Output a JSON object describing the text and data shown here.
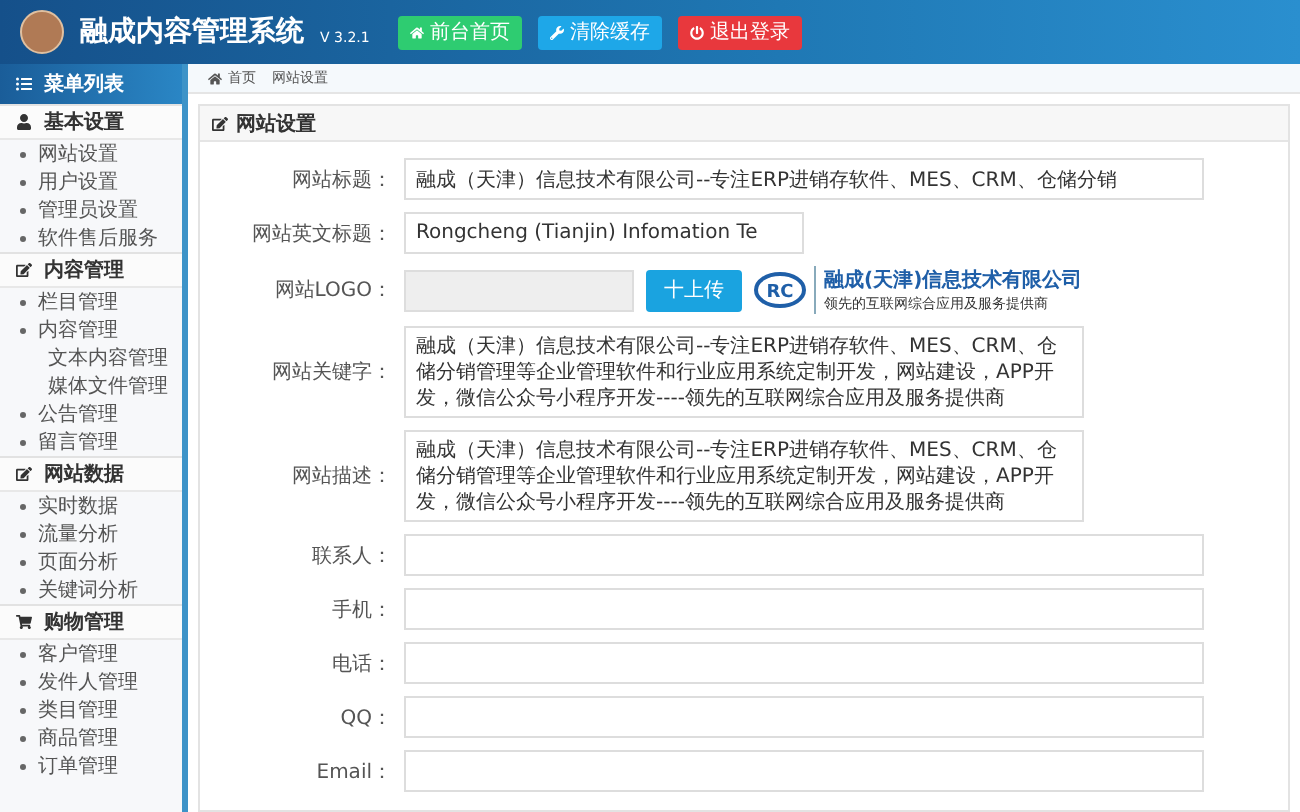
{
  "header": {
    "title": "融成内容管理系统",
    "version": "V 3.2.1",
    "buttons": [
      {
        "kind": "home",
        "label": "前台首页",
        "color": "#2ecc71"
      },
      {
        "kind": "clear",
        "label": "清除缓存",
        "color": "#1ea7e8"
      },
      {
        "kind": "logout",
        "label": "退出登录",
        "color": "#e8383d"
      }
    ]
  },
  "sidebar": {
    "title": "菜单列表",
    "groups": [
      {
        "kind": "user",
        "label": "基本设置",
        "items": [
          {
            "label": "网站设置"
          },
          {
            "label": "用户设置"
          },
          {
            "label": "管理员设置"
          },
          {
            "label": "软件售后服务"
          }
        ]
      },
      {
        "kind": "edit",
        "label": "内容管理",
        "items": [
          {
            "label": "栏目管理"
          },
          {
            "label": "内容管理",
            "children": [
              {
                "label": "文本内容管理"
              },
              {
                "label": "媒体文件管理"
              }
            ]
          },
          {
            "label": "公告管理"
          },
          {
            "label": "留言管理"
          }
        ]
      },
      {
        "kind": "edit",
        "label": "网站数据",
        "items": [
          {
            "label": "实时数据"
          },
          {
            "label": "流量分析"
          },
          {
            "label": "页面分析"
          },
          {
            "label": "关键词分析"
          }
        ]
      },
      {
        "kind": "cart",
        "label": "购物管理",
        "items": [
          {
            "label": "客户管理"
          },
          {
            "label": "发件人管理"
          },
          {
            "label": "类目管理"
          },
          {
            "label": "商品管理"
          },
          {
            "label": "订单管理"
          }
        ]
      }
    ]
  },
  "breadcrumb": [
    "首页",
    "网站设置"
  ],
  "panel": {
    "title": "网站设置",
    "fields": [
      {
        "kind": "input",
        "label": "网站标题：",
        "value": "融成（天津）信息技术有限公司--专注ERP进销存软件、MES、CRM、仓储分销",
        "wide": true
      },
      {
        "kind": "input",
        "label": "网站英文标题：",
        "value": "Rongcheng (Tianjin) Infomation Te",
        "wide": false
      },
      {
        "kind": "logo",
        "label": "网站LOGO：",
        "button": "十上传",
        "logo_text": "融成(天津)信息技术有限公司",
        "logo_sub": "领先的互联网综合应用及服务提供商",
        "logo_mark": "RC"
      },
      {
        "kind": "textarea",
        "label": "网站关键字：",
        "value": "融成（天津）信息技术有限公司--专注ERP进销存软件、MES、CRM、仓储分销管理等企业管理软件和行业应用系统定制开发，网站建设，APP开发，微信公众号小程序开发----领先的互联网综合应用及服务提供商"
      },
      {
        "kind": "textarea",
        "label": "网站描述：",
        "value": "融成（天津）信息技术有限公司--专注ERP进销存软件、MES、CRM、仓储分销管理等企业管理软件和行业应用系统定制开发，网站建设，APP开发，微信公众号小程序开发----领先的互联网综合应用及服务提供商"
      },
      {
        "kind": "input",
        "label": "联系人：",
        "wide": true
      },
      {
        "kind": "input",
        "label": "手机：",
        "wide": true
      },
      {
        "kind": "input",
        "label": "电话：",
        "wide": true
      },
      {
        "kind": "input",
        "label": "QQ：",
        "wide": true
      },
      {
        "kind": "input",
        "label": "Email：",
        "wide": true
      }
    ]
  }
}
